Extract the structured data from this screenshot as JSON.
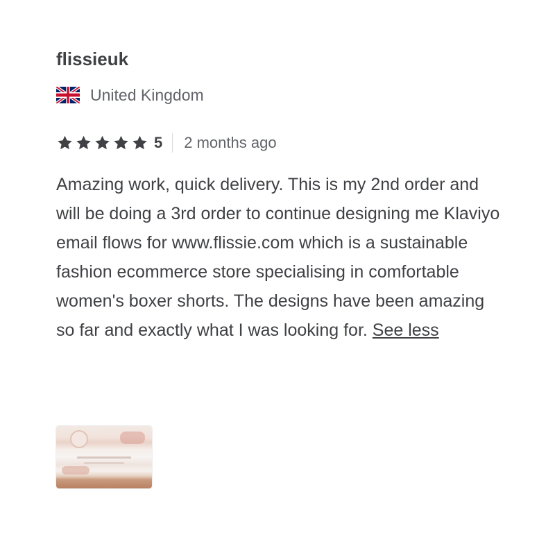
{
  "review": {
    "username": "flissieuk",
    "country": "United Kingdom",
    "flag_icon": "uk-flag-icon",
    "rating": 5,
    "rating_label": "5",
    "time_ago": "2 months ago",
    "body": "Amazing work, quick delivery. This is my 2nd order and will be doing a 3rd order to continue designing me Klaviyo email flows for www.flissie.com which is a sustainable fashion ecommerce store specialising in comfortable women's boxer shorts. The designs have been amazing so far and exactly what I was looking for.",
    "see_less_label": "See less",
    "star_icon": "star-icon",
    "attachment_icon": "review-image-thumbnail"
  },
  "colors": {
    "text": "#404145",
    "muted": "#62646a",
    "star": "#404145",
    "divider": "#dadbdd"
  }
}
